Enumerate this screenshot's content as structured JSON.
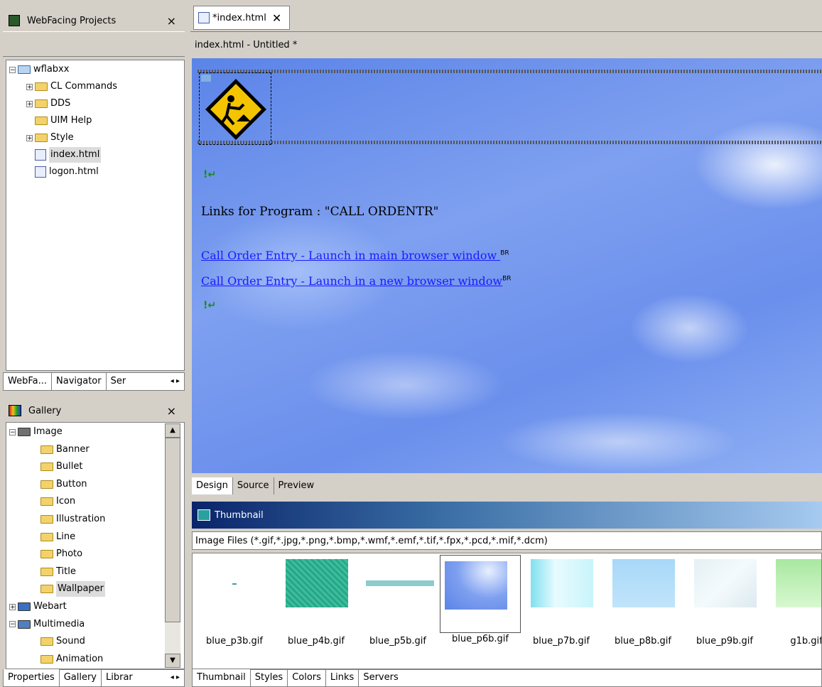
{
  "left_top": {
    "title": "WebFacing Projects",
    "close": "×",
    "tree": [
      {
        "label": "wflabxx",
        "depth": 0,
        "exp": "−",
        "icon": "project"
      },
      {
        "label": "CL Commands",
        "depth": 1,
        "exp": "+",
        "icon": "folder"
      },
      {
        "label": "DDS",
        "depth": 1,
        "exp": "+",
        "icon": "folder"
      },
      {
        "label": "UIM Help",
        "depth": 1,
        "exp": "",
        "icon": "folder"
      },
      {
        "label": "Style",
        "depth": 1,
        "exp": "+",
        "icon": "style"
      },
      {
        "label": "index.html",
        "depth": 1,
        "exp": "",
        "icon": "page",
        "selected": true
      },
      {
        "label": "logon.html",
        "depth": 1,
        "exp": "",
        "icon": "page"
      }
    ],
    "tabs": [
      "WebFa...",
      "Navigator",
      "Ser"
    ]
  },
  "gallery": {
    "title": "Gallery",
    "close": "×",
    "tree": [
      {
        "label": "Image",
        "depth": 0,
        "exp": "−"
      },
      {
        "label": "Banner",
        "depth": 1
      },
      {
        "label": "Bullet",
        "depth": 1
      },
      {
        "label": "Button",
        "depth": 1
      },
      {
        "label": "Icon",
        "depth": 1
      },
      {
        "label": "Illustration",
        "depth": 1
      },
      {
        "label": "Line",
        "depth": 1
      },
      {
        "label": "Photo",
        "depth": 1
      },
      {
        "label": "Title",
        "depth": 1
      },
      {
        "label": "Wallpaper",
        "depth": 1,
        "selected": true
      },
      {
        "label": "Webart",
        "depth": 0,
        "exp": "+"
      },
      {
        "label": "Multimedia",
        "depth": 0,
        "exp": "−"
      },
      {
        "label": "Sound",
        "depth": 1
      },
      {
        "label": "Animation",
        "depth": 1
      }
    ],
    "tabs": [
      "Properties",
      "Gallery",
      "Librar"
    ]
  },
  "editor": {
    "tab_label": "*index.html",
    "close": "✕",
    "breadcrumb": "index.html - Untitled *",
    "heading": "Links for Program : \"CALL ORDENTR\"",
    "link1": "Call Order Entry - Launch in main browser window ",
    "link2": "Call Order Entry - Launch in a new browser window",
    "br_marker": "BR",
    "mode_tabs": [
      "Design",
      "Source",
      "Preview"
    ]
  },
  "thumbnail": {
    "title": "Thumbnail",
    "filter": "Image Files (*.gif,*.jpg,*.png,*.bmp,*.wmf,*.emf,*.tif,*.fpx,*.pcd,*.mif,*.dcm)",
    "items": [
      "blue_p3b.gif",
      "blue_p4b.gif",
      "blue_p5b.gif",
      "blue_p6b.gif",
      "blue_p7b.gif",
      "blue_p8b.gif",
      "blue_p9b.gif",
      "g1b.gif"
    ],
    "selected_index": 3,
    "tabs": [
      "Thumbnail",
      "Styles",
      "Colors",
      "Links",
      "Servers"
    ]
  },
  "colors": {
    "link": "#1a1aff",
    "selection": "#dcdcdc",
    "thumb_bar_start": "#0a246a",
    "thumb_bar_end": "#a6caf0"
  }
}
